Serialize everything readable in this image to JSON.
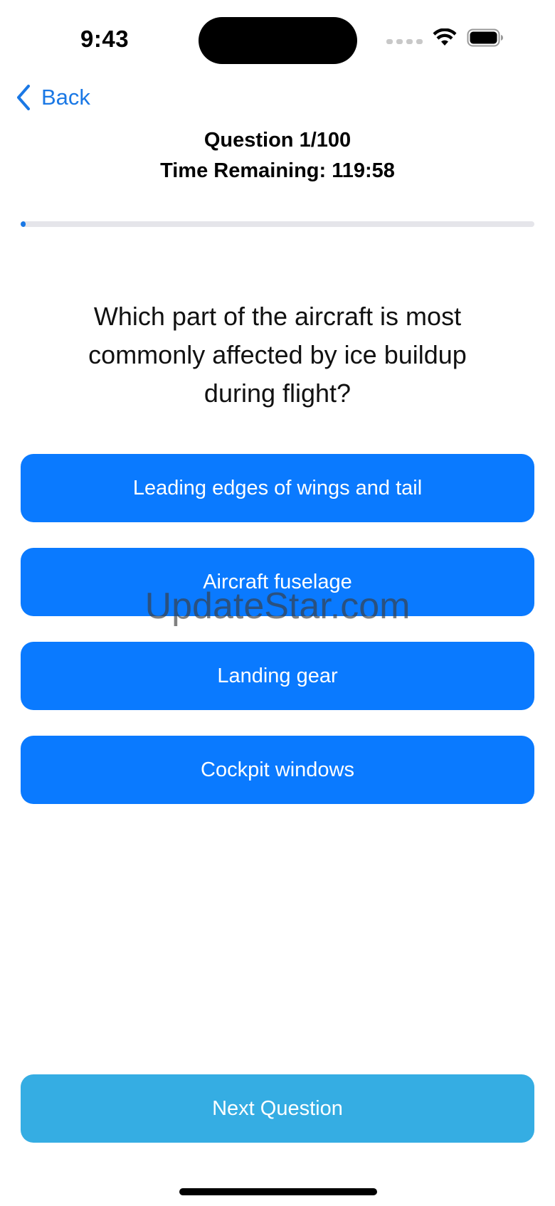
{
  "status_bar": {
    "time": "9:43"
  },
  "nav": {
    "back_label": "Back"
  },
  "quiz": {
    "question_counter": "Question 1/100",
    "time_remaining": "Time Remaining: 119:58",
    "progress_fraction": 0.01,
    "question": "Which part of the aircraft is most commonly affected by ice buildup during flight?",
    "answers": [
      "Leading edges of wings and tail",
      "Aircraft fuselage",
      "Landing gear",
      "Cockpit windows"
    ],
    "next_label": "Next Question"
  },
  "watermark": "UpdateStar.com",
  "colors": {
    "accent": "#0a7aff",
    "back_blue": "#1a78e5",
    "next_button": "#35ade3",
    "progress_track": "#e5e5ea"
  },
  "icons": {
    "back": "chevron-left-icon",
    "wifi": "wifi-icon",
    "battery": "battery-icon",
    "signal": "cellular-signal-icon"
  }
}
